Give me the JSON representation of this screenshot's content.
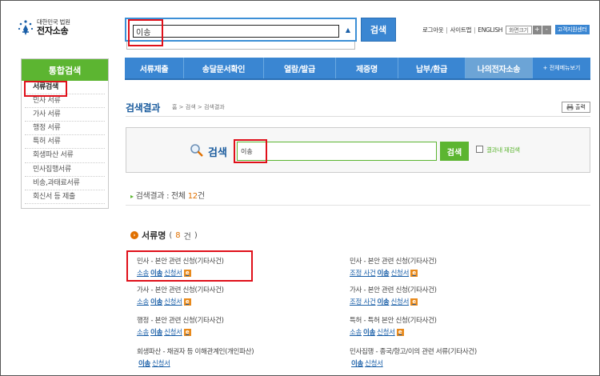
{
  "header": {
    "logo_line1": "대한민국 법원",
    "logo_line2": "전자소송",
    "search_value": "이송",
    "search_button": "검색",
    "util_links": [
      "로그아웃",
      "사이트맵",
      "ENGLISH"
    ],
    "font_size_label": "화면크기",
    "font_plus": "+",
    "font_minus": "-",
    "customer_center": "고객지원센터"
  },
  "nav": {
    "items": [
      "서류제출",
      "송달문서확인",
      "열람/발급",
      "제증명",
      "납부/환급",
      "나의전자소송"
    ],
    "all_menu": "+ 전체메뉴보기"
  },
  "sidebar": {
    "title": "통합검색",
    "items": [
      "서류검색",
      "민사 서류",
      "가사 서류",
      "행정 서류",
      "특허 서류",
      "회생파산 서류",
      "민사집행서류",
      "비송,과태료서류",
      "회신서 등 제출"
    ]
  },
  "content": {
    "title": "검색결과",
    "breadcrumb": "홈 > 검색 > 검색결과",
    "print": "출력",
    "search_label": "검색",
    "search_value": "이송",
    "search_button": "검색",
    "within_results": "결과내 재검색",
    "result_prefix": "검색결과 : 전체 ",
    "result_num": "12",
    "result_suffix": "건",
    "section_title": "서류명",
    "section_count": "8",
    "section_count_tail": "건",
    "docs": [
      {
        "category": "민사 - 본안 관련 신청(기타사건)",
        "pre": "소송",
        "hl": "이송",
        "post": "신청서",
        "icon": true
      },
      {
        "category": "민사 - 본안 관련 신청(기타사건)",
        "pre": "조정 사건",
        "hl": "이송",
        "post": "신청서",
        "icon": true
      },
      {
        "category": "가사 - 본안 관련 신청(기타사건)",
        "pre": "소송",
        "hl": "이송",
        "post": "신청서",
        "icon": true
      },
      {
        "category": "가사 - 본안 관련 신청(기타사건)",
        "pre": "조정 사건",
        "hl": "이송",
        "post": "신청서",
        "icon": true
      },
      {
        "category": "행정 - 본안 관련 신청(기타사건)",
        "pre": "소송",
        "hl": "이송",
        "post": "신청서",
        "icon": true
      },
      {
        "category": "특허 - 특허 본안 신청(기타사건)",
        "pre": "소송",
        "hl": "이송",
        "post": "신청서",
        "icon": true
      },
      {
        "category": "회생파산 - 채권자 등 이해관계인(개인파산)",
        "pre": "",
        "hl": "이송",
        "post": "신청서",
        "icon": false
      },
      {
        "category": "민사집행 - 종국/항고/이의 관련 서류(기타사건)",
        "pre": "",
        "hl": "이송",
        "post": "신청서",
        "icon": false
      }
    ]
  },
  "colors": {
    "brand_blue": "#3a86d2",
    "brand_green": "#5cb531",
    "accent_orange": "#e07000",
    "highlight_red": "#e0101a"
  }
}
